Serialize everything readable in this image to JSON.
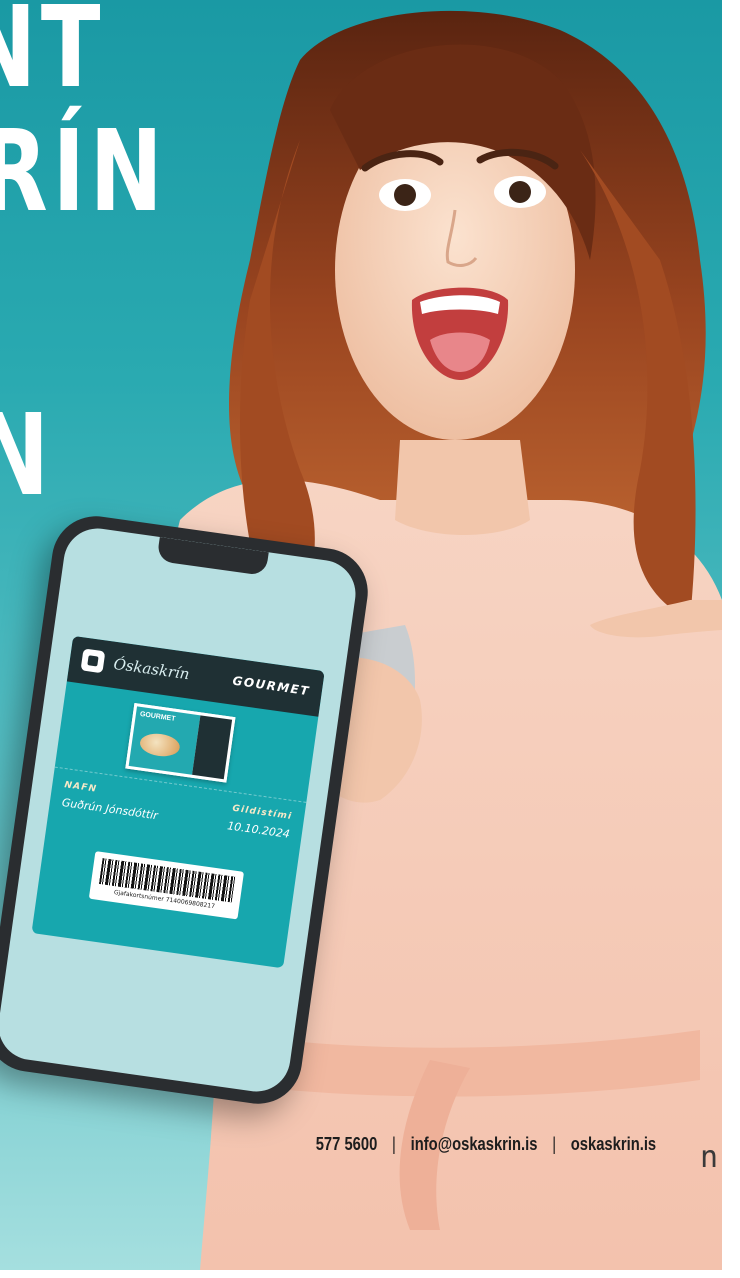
{
  "headline": {
    "line1": "NT",
    "line2": "KRÍN",
    "line3": "N"
  },
  "clipped_text": "n",
  "wallet_card": {
    "brand": "Óskaskrín",
    "type": "GOURMET",
    "mini_card_label": "GOURMET",
    "name_label": "NAFN",
    "name_value": "Guðrún Jónsdóttir",
    "valid_label": "Gildistími",
    "valid_value": "10.10.2024",
    "barcode_caption": "Gjafakortsnúmer 7140069808217"
  },
  "contact": {
    "phone": "577 5600",
    "email": "info@oskaskrin.is",
    "website": "oskaskrin.is",
    "separator": "|"
  },
  "colors": {
    "background": "#1a99a4",
    "card_teal": "#17a7ae",
    "card_dark": "#1f3034",
    "dress": "#f6c8b4",
    "hair": "#8a3a1c"
  }
}
